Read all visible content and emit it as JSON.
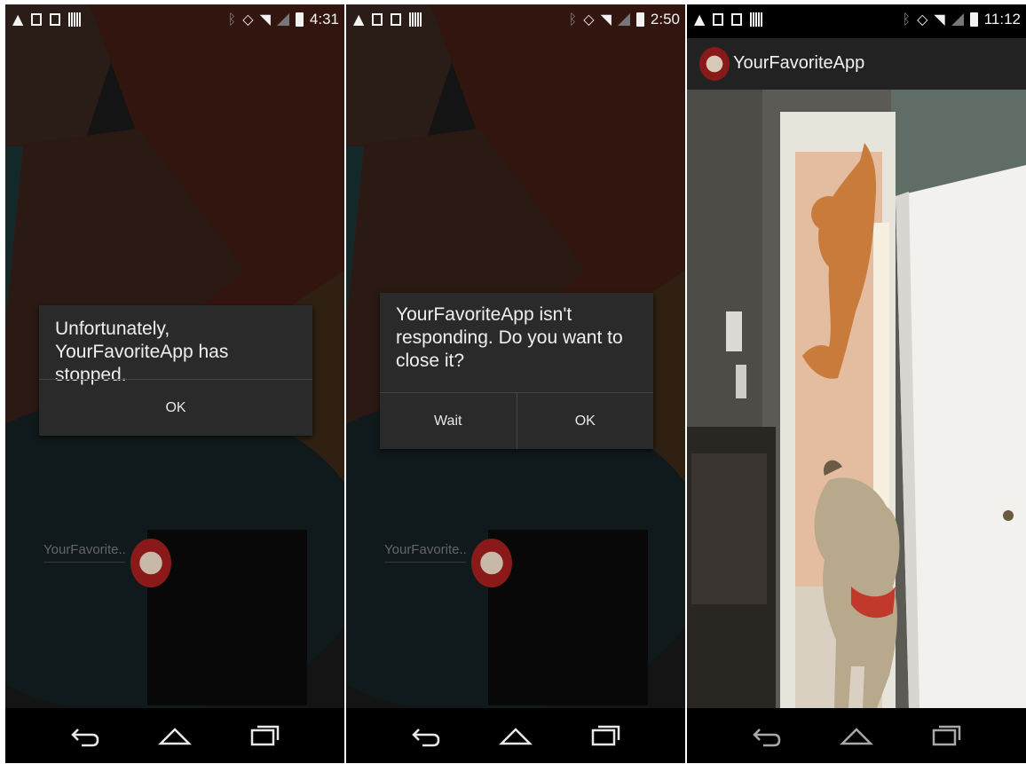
{
  "screens": [
    {
      "status": {
        "time": "4:31"
      },
      "dialog": {
        "message": "Unfortunately, YourFavoriteApp has stopped.",
        "buttons": [
          "OK"
        ]
      },
      "widget": {
        "label": "YourFavorite.."
      }
    },
    {
      "status": {
        "time": "2:50"
      },
      "dialog": {
        "message": "YourFavoriteApp isn't responding. Do you want to close it?",
        "buttons": [
          "Wait",
          "OK"
        ]
      },
      "widget": {
        "label": "YourFavorite.."
      }
    },
    {
      "status": {
        "time": "11:12"
      },
      "actionbar": {
        "title": "YourFavoriteApp"
      }
    }
  ],
  "icons": {
    "status_left": [
      "warning-icon",
      "download-icon",
      "image-icon",
      "barcode-icon"
    ],
    "status_right": [
      "bluetooth-icon",
      "vibrate-icon",
      "wifi-icon",
      "signal-icon",
      "battery-charging-icon"
    ],
    "nav": [
      "back-icon",
      "home-icon",
      "recents-icon"
    ]
  },
  "colors": {
    "dialog_bg": "#2a2a2a",
    "actionbar_bg": "#222222",
    "navbar_bg": "#000000"
  }
}
